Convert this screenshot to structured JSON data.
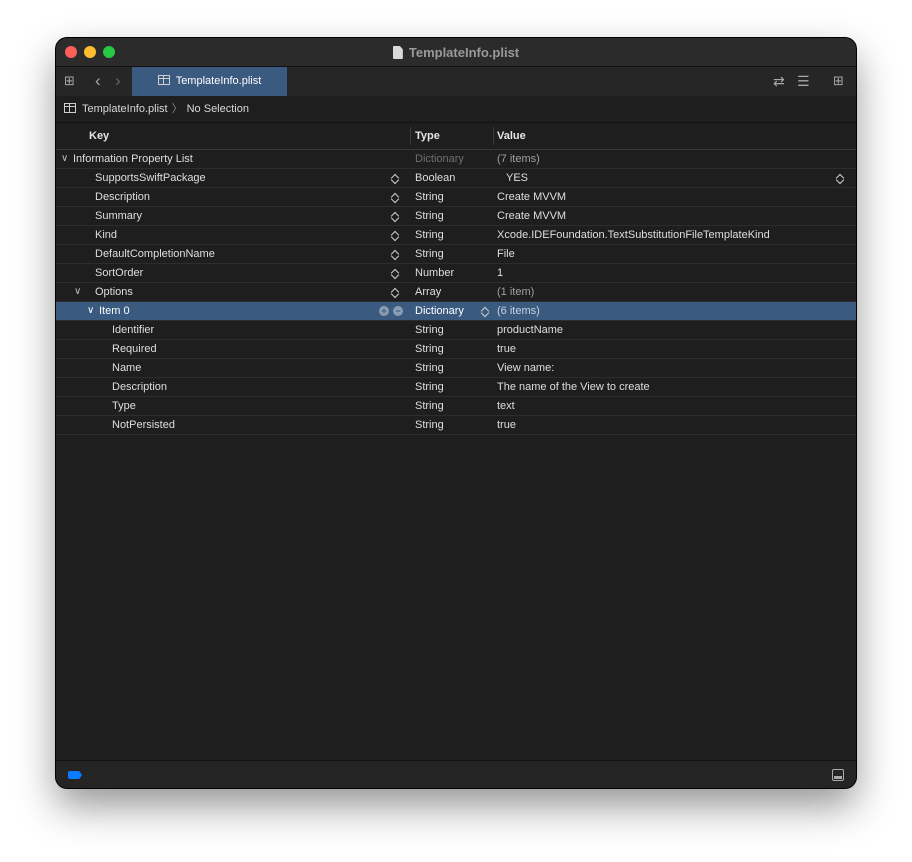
{
  "window": {
    "title": "TemplateInfo.plist"
  },
  "toolbar": {
    "tab_label": "TemplateInfo.plist",
    "icons": [
      "grid-icon",
      "back-icon",
      "forward-icon",
      "swap-icon",
      "lines-icon",
      "add-editor-icon"
    ]
  },
  "jumpbar": {
    "file": "TemplateInfo.plist",
    "selection": "No Selection"
  },
  "columns": {
    "key": "Key",
    "type": "Type",
    "value": "Value"
  },
  "rows": [
    {
      "key": "Information Property List",
      "type": "Dictionary",
      "value": "(7 items)"
    },
    {
      "key": "SupportsSwiftPackage",
      "type": "Boolean",
      "value": "YES"
    },
    {
      "key": "Description",
      "type": "String",
      "value": "Create MVVM"
    },
    {
      "key": "Summary",
      "type": "String",
      "value": "Create MVVM"
    },
    {
      "key": "Kind",
      "type": "String",
      "value": "Xcode.IDEFoundation.TextSubstitutionFileTemplateKind"
    },
    {
      "key": "DefaultCompletionName",
      "type": "String",
      "value": "File"
    },
    {
      "key": "SortOrder",
      "type": "Number",
      "value": "1"
    },
    {
      "key": "Options",
      "type": "Array",
      "value": "(1 item)"
    },
    {
      "key": "Item 0",
      "type": "Dictionary",
      "value": "(6 items)"
    },
    {
      "key": "Identifier",
      "type": "String",
      "value": "productName"
    },
    {
      "key": "Required",
      "type": "String",
      "value": "true"
    },
    {
      "key": "Name",
      "type": "String",
      "value": "View name:"
    },
    {
      "key": "Description",
      "type": "String",
      "value": "The name of the View to create"
    },
    {
      "key": "Type",
      "type": "String",
      "value": "text"
    },
    {
      "key": "NotPersisted",
      "type": "String",
      "value": "true"
    }
  ],
  "colors": {
    "accent": "#3a5a80",
    "blue_tag": "#0a7cff"
  }
}
